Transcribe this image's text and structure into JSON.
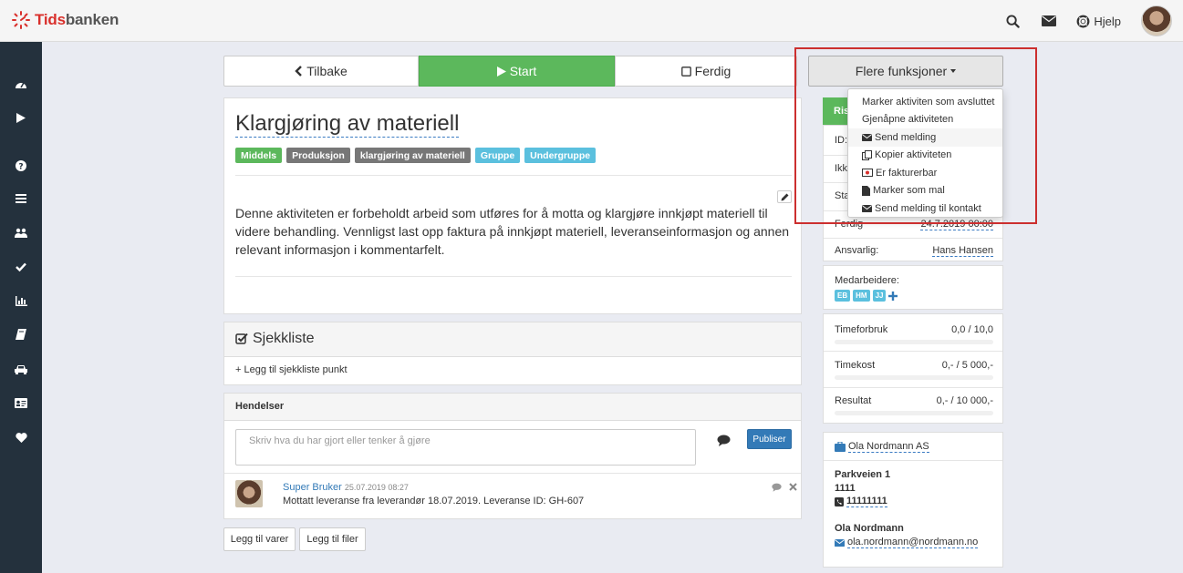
{
  "app": {
    "logo_red": "Tids",
    "logo_rest": "banken",
    "help_label": "Hjelp"
  },
  "actions": {
    "back_label": "Tilbake",
    "start_label": "Start",
    "done_label": "Ferdig",
    "more_label": "Flere funksjoner"
  },
  "dropdown": {
    "items": [
      "Marker aktiviten som avsluttet",
      "Gjenåpne aktiviteten",
      "Send melding",
      "Kopier aktiviteten",
      "Er fakturerbar",
      "Marker som mal",
      "Send melding til kontakt"
    ]
  },
  "activity": {
    "title": "Klargjøring av materiell",
    "labels": [
      "Middels",
      "Produksjon",
      "klargjøring av materiell",
      "Gruppe",
      "Undergruppe"
    ],
    "description": "Denne aktiviteten er forbeholdt arbeid som utføres for å motta og klargjøre innkjøpt materiell til videre behandling. Vennligst last opp faktura på innkjøpt materiell, leveranseinformasjon og annen relevant informasjon i kommentarfelt."
  },
  "checklist": {
    "title": "Sjekkliste",
    "add_label": "+ Legg til sjekkliste punkt"
  },
  "events": {
    "title": "Hendelser",
    "placeholder": "Skriv hva du har gjort eller tenker å gjøre",
    "publish_label": "Publiser",
    "entry": {
      "user": "Super Bruker",
      "time": "25.07.2019 08:27",
      "text": "Mottatt leveranse fra leverandør 18.07.2019. Leveranse ID: GH-607"
    }
  },
  "bottom_buttons": {
    "items_label": "Legg til varer",
    "files_label": "Legg til filer"
  },
  "details": {
    "header_partial": "Ris",
    "id_label": "ID:",
    "row2_partial": "Ikk",
    "row3_partial": "Sta",
    "done_label": "Ferdig",
    "done_value": "24.7.2019 00:00",
    "responsible_label": "Ansvarlig:",
    "responsible_value": "Hans Hansen",
    "coworkers_label": "Medarbeidere:",
    "coworkers": [
      "EB",
      "HM",
      "JJ"
    ],
    "metrics": [
      {
        "label": "Timeforbruk",
        "value": "0,0 / 10,0"
      },
      {
        "label": "Timekost",
        "value": "0,- / 5 000,-"
      },
      {
        "label": "Resultat",
        "value": "0,- / 10 000,-"
      }
    ]
  },
  "contact": {
    "company": "Ola Nordmann AS",
    "street": "Parkveien 1",
    "postcode": "1111",
    "phone": "11111111",
    "name": "Ola Nordmann",
    "email": "ola.nordmann@nordmann.no"
  },
  "colors": {
    "green": "#5cb85c",
    "grey_label": "#777777",
    "info": "#5bc0de",
    "primary": "#337ab7",
    "sidebar": "#24313d",
    "highlight": "#cc2f2f"
  }
}
